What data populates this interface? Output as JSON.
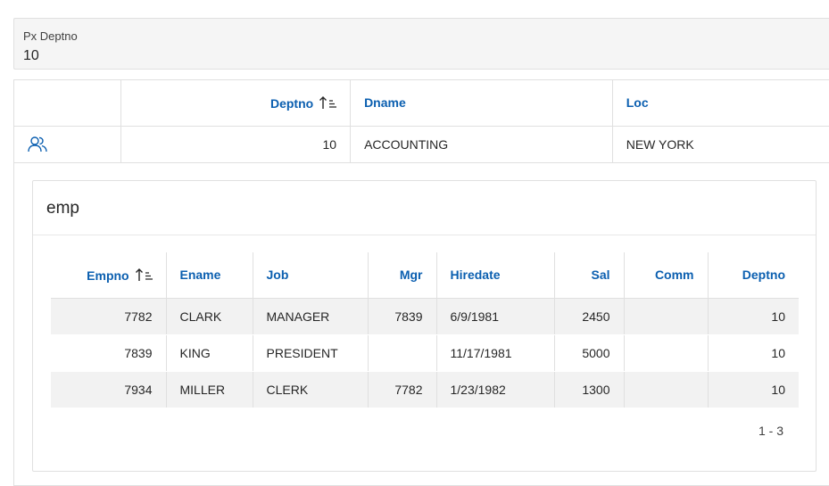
{
  "param": {
    "label": "Px Deptno",
    "value": "10"
  },
  "dept": {
    "columns": {
      "deptno": "Deptno",
      "dname": "Dname",
      "loc": "Loc"
    },
    "row": {
      "deptno": "10",
      "dname": "ACCOUNTING",
      "loc": "NEW YORK",
      "link_icon": "users-icon"
    }
  },
  "emp": {
    "title": "emp",
    "columns": {
      "empno": "Empno",
      "ename": "Ename",
      "job": "Job",
      "mgr": "Mgr",
      "hiredate": "Hiredate",
      "sal": "Sal",
      "comm": "Comm",
      "deptno": "Deptno"
    },
    "rows": [
      {
        "empno": "7782",
        "ename": "CLARK",
        "job": "MANAGER",
        "mgr": "7839",
        "hiredate": "6/9/1981",
        "sal": "2450",
        "comm": "",
        "deptno": "10"
      },
      {
        "empno": "7839",
        "ename": "KING",
        "job": "PRESIDENT",
        "mgr": "",
        "hiredate": "11/17/1981",
        "sal": "5000",
        "comm": "",
        "deptno": "10"
      },
      {
        "empno": "7934",
        "ename": "MILLER",
        "job": "CLERK",
        "mgr": "7782",
        "hiredate": "1/23/1982",
        "sal": "1300",
        "comm": "",
        "deptno": "10"
      }
    ],
    "pagination": "1 - 3"
  },
  "colors": {
    "header_link": "#0b5fb0",
    "stripe": "#f2f2f2",
    "border": "#e0e0e0"
  }
}
